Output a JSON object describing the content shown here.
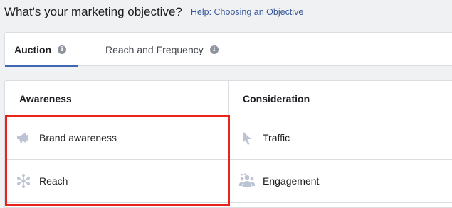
{
  "header": {
    "title": "What's your marketing objective?",
    "help_link": "Help: Choosing an Objective"
  },
  "tabs": [
    {
      "label": "Auction",
      "active": true
    },
    {
      "label": "Reach and Frequency",
      "active": false
    }
  ],
  "columns": [
    {
      "heading": "Awareness",
      "items": [
        {
          "label": "Brand awareness",
          "icon": "megaphone-icon"
        },
        {
          "label": "Reach",
          "icon": "reach-snowflake-icon"
        }
      ]
    },
    {
      "heading": "Consideration",
      "items": [
        {
          "label": "Traffic",
          "icon": "cursor-arrow-icon"
        },
        {
          "label": "Engagement",
          "icon": "people-icon"
        }
      ]
    }
  ],
  "colors": {
    "accent": "#4267b2",
    "link": "#365899",
    "highlight": "#e8231b",
    "icon": "#bcc4d3"
  }
}
